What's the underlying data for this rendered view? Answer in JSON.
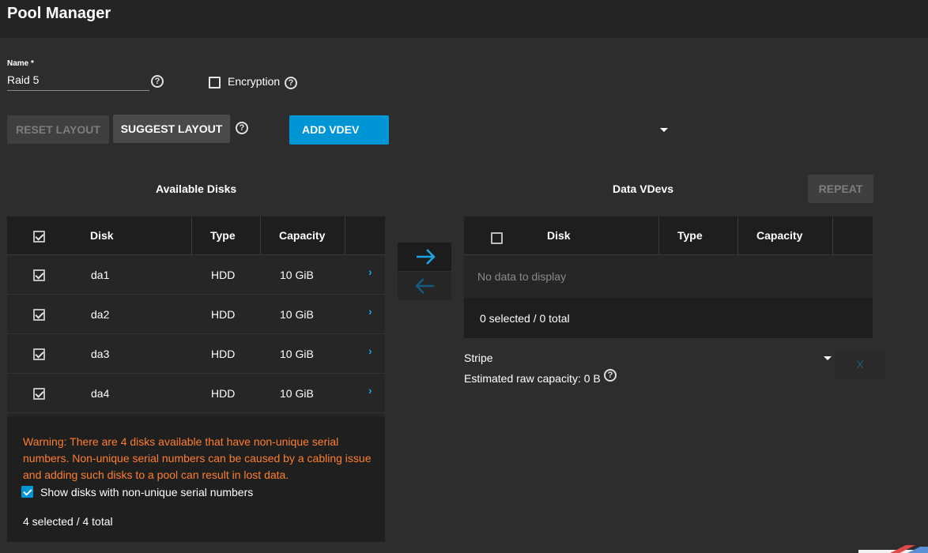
{
  "header": {
    "title": "Pool Manager"
  },
  "name_field": {
    "label": "Name *",
    "value": "Raid 5"
  },
  "encryption": {
    "label": "Encryption",
    "checked": false
  },
  "buttons": {
    "reset": "RESET LAYOUT",
    "suggest": "SUGGEST LAYOUT",
    "add_vdev": "ADD VDEV",
    "repeat": "REPEAT",
    "remove": "X"
  },
  "available": {
    "title": "Available Disks",
    "columns": [
      "Disk",
      "Type",
      "Capacity"
    ],
    "rows": [
      {
        "disk": "da1",
        "type": "HDD",
        "capacity": "10 GiB",
        "checked": true
      },
      {
        "disk": "da2",
        "type": "HDD",
        "capacity": "10 GiB",
        "checked": true
      },
      {
        "disk": "da3",
        "type": "HDD",
        "capacity": "10 GiB",
        "checked": true
      },
      {
        "disk": "da4",
        "type": "HDD",
        "capacity": "10 GiB",
        "checked": true
      }
    ],
    "warning": "Warning: There are 4 disks available that have non-unique serial numbers. Non-unique serial numbers can be caused by a cabling issue and adding such disks to a pool can result in lost data.",
    "show_nonunique_label": "Show disks with non-unique serial numbers",
    "count": "4 selected / 4 total"
  },
  "data_vdevs": {
    "title": "Data VDevs",
    "columns": [
      "Disk",
      "Type",
      "Capacity"
    ],
    "empty_text": "No data to display",
    "count": "0 selected / 0 total",
    "layout": "Stripe",
    "estimated": "Estimated raw capacity: 0 B"
  },
  "icons": {
    "help": "help-circle-icon",
    "move_right": "arrow-right-icon",
    "move_left": "arrow-left-icon",
    "expand": "chevron-right-icon"
  },
  "colors": {
    "accent": "#0095d5",
    "warning": "#ff7e2e",
    "background": "#2d2d2d",
    "header": "#242424"
  }
}
